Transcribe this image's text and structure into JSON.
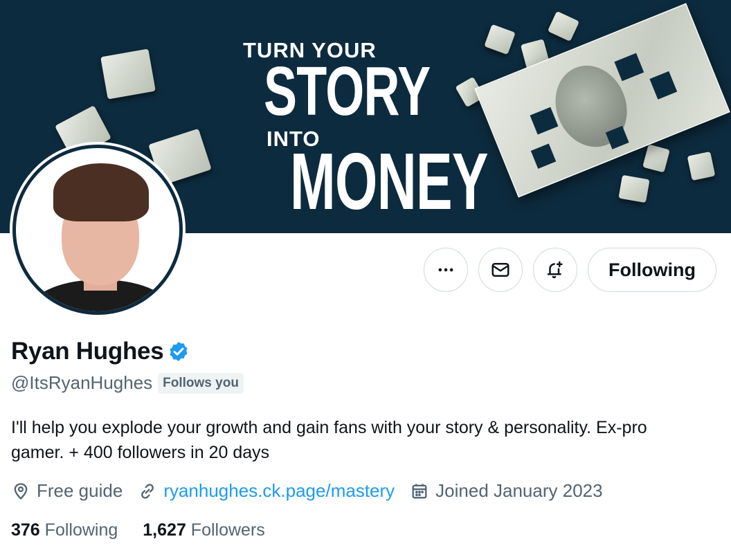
{
  "banner": {
    "line1": "TURN YOUR",
    "line2": "STORY",
    "line3": "INTO",
    "line4": "MONEY"
  },
  "profile": {
    "name": "Ryan Hughes",
    "verified": true,
    "handle": "@ItsRyanHughes",
    "follows_you_badge": "Follows you",
    "bio": "I'll help you explode your growth and gain fans with your story & personality. Ex-pro gamer. + 400 followers in 20 days",
    "location": "Free guide",
    "website": "ryanhughes.ck.page/mastery",
    "joined": "Joined January 2023",
    "following_count": "376",
    "following_label": "Following",
    "followers_count": "1,627",
    "followers_label": "Followers"
  },
  "actions": {
    "more_icon": "more-horizontal-icon",
    "message_icon": "mail-icon",
    "notify_icon": "bell-plus-icon",
    "following_button": "Following"
  },
  "colors": {
    "banner_bg": "#0d2b3e",
    "link": "#1d9bf0",
    "secondary_text": "#536471",
    "verified": "#1d9bf0"
  }
}
